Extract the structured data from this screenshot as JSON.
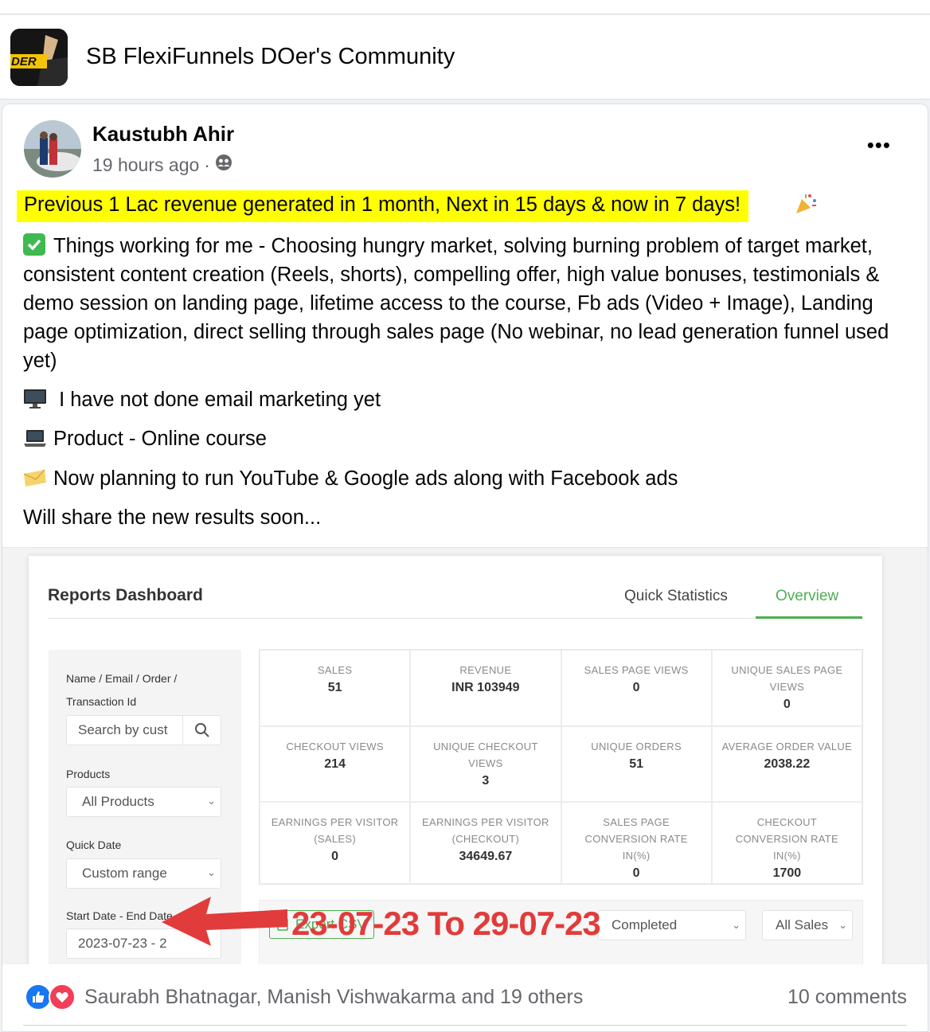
{
  "group": {
    "name": "SB FlexiFunnels DOer's Community",
    "logo_text": "DER"
  },
  "post": {
    "author": "Kaustubh Ahir",
    "time": "19 hours ago",
    "separator": "·",
    "highlight": "Previous 1 Lac revenue generated in 1 month, Next in 15 days & now in 7 days!",
    "paragraphs": {
      "things_working": "Things working for me -  Choosing hungry market, solving burning problem of target market, consistent content creation (Reels, shorts), compelling offer, high value bonuses, testimonials & demo session on landing page, lifetime access to the course, Fb ads (Video + Image), Landing page optimization, direct selling through sales page (No webinar, no lead generation funnel used yet)",
      "email": " I have not done email marketing yet",
      "product": "Product - Online course",
      "planning": "Now planning to run YouTube & Google ads along with Facebook ads",
      "closing": "Will share the new results soon..."
    },
    "icons": {
      "privacy": "group-icon",
      "party": "party-popper-icon",
      "check": "check-mark-icon",
      "desktop": "desktop-icon",
      "laptop": "laptop-icon",
      "envelope": "envelope-icon"
    }
  },
  "dashboard": {
    "title": "Reports Dashboard",
    "tabs": [
      "Quick Statistics",
      "Overview"
    ],
    "active_tab": "Overview",
    "accent_color": "#4caf50",
    "filters": {
      "search_label_1": "Name / Email / Order /",
      "search_label_2": "Transaction Id",
      "search_placeholder": "Search by cust",
      "products_label": "Products",
      "products_value": "All Products",
      "quick_date_label": "Quick Date",
      "quick_date_value": "Custom range",
      "date_label": "Start Date - End Date",
      "date_value": "2023-07-23 - 2"
    },
    "stats": [
      {
        "label": "SALES",
        "value": "51"
      },
      {
        "label": "REVENUE",
        "value": "INR 103949"
      },
      {
        "label": "SALES PAGE VIEWS",
        "value": "0"
      },
      {
        "label": "UNIQUE SALES PAGE VIEWS",
        "value": "0"
      },
      {
        "label": "CHECKOUT VIEWS",
        "value": "214"
      },
      {
        "label": "UNIQUE CHECKOUT VIEWS",
        "value": "3"
      },
      {
        "label": "UNIQUE ORDERS",
        "value": "51"
      },
      {
        "label": "AVERAGE ORDER VALUE",
        "value": "2038.22"
      },
      {
        "label": "EARNINGS PER VISITOR (SALES)",
        "value": "0"
      },
      {
        "label": "EARNINGS PER VISITOR (CHECKOUT)",
        "value": "34649.67"
      },
      {
        "label": "SALES PAGE CONVERSION RATE IN(%)",
        "value": "0"
      },
      {
        "label": "CHECKOUT CONVERSION RATE IN(%)",
        "value": "1700"
      }
    ],
    "export_label": "Export CSV",
    "status_value": "Completed",
    "type_value": "All Sales",
    "annotation": "23-07-23 To 29-07-23",
    "annotation_color": "#e23b3b"
  },
  "footer": {
    "reaction_icons": [
      "like-icon",
      "love-icon"
    ],
    "likers": "Saurabh Bhatnagar, Manish Vishwakarma and 19 others",
    "comments": "10 comments"
  }
}
